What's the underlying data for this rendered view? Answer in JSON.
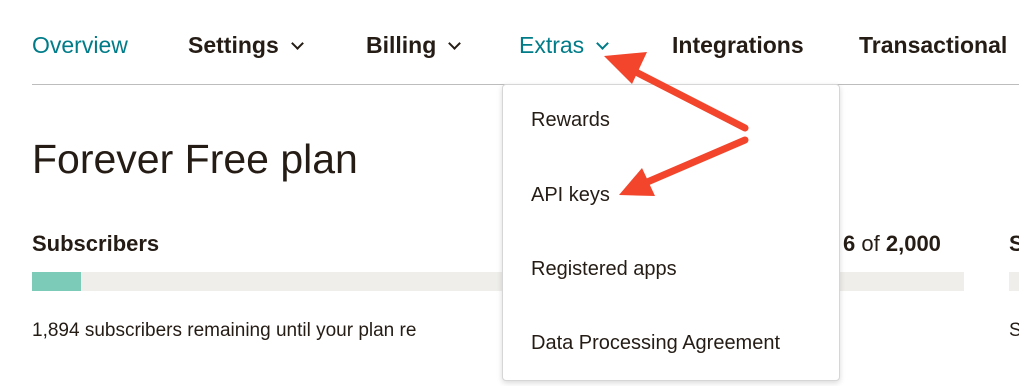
{
  "nav": {
    "overview": "Overview",
    "settings": "Settings",
    "billing": "Billing",
    "extras": "Extras",
    "integrations": "Integrations",
    "transactional": "Transactional"
  },
  "plan": {
    "title": "Forever Free plan"
  },
  "subscribers": {
    "label": "Subscribers",
    "count_partial": "6",
    "of": "of",
    "limit": "2,000",
    "remaining": "1,894 subscribers remaining until your plan re",
    "progress_fraction": 0.053
  },
  "side_cut": {
    "label_a": "S",
    "label_b": "S"
  },
  "extras_menu": {
    "items": [
      "Rewards",
      "API keys",
      "Registered apps",
      "Data Processing Agreement"
    ]
  },
  "annotation": {
    "arrow_color": "#f2452b"
  },
  "colors": {
    "accent": "#007c89",
    "progress": "#7ccbb8"
  }
}
